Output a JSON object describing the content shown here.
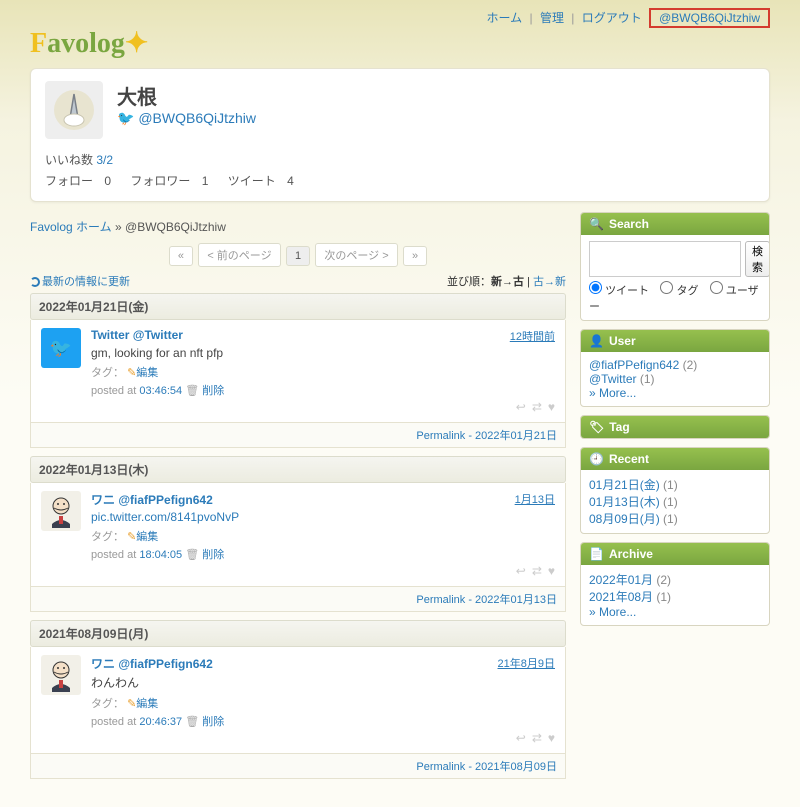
{
  "topbar": {
    "home": "ホーム",
    "admin": "管理",
    "logout": "ログアウト",
    "user": "@BWQB6QiJtzhiw"
  },
  "profile": {
    "display_name": "大根",
    "handle": "@BWQB6QiJtzhiw",
    "likes_label": "いいね数",
    "likes_ratio": "3/2",
    "follow_label": "フォロー",
    "follow_count": "0",
    "follower_label": "フォロワー",
    "follower_count": "1",
    "tweet_label": "ツイート",
    "tweet_count": "4"
  },
  "breadcrumb": {
    "home": "Favolog ホーム",
    "sep": " » ",
    "current": "@BWQB6QiJtzhiw"
  },
  "pager": {
    "first": "«",
    "prev": "< 前のページ",
    "page": "1",
    "next": "次のページ >",
    "last": "»"
  },
  "toolbar": {
    "refresh": "最新の情報に更新",
    "sort_label": "並び順：",
    "sort_new": "新→古",
    "sort_sep": " | ",
    "sort_old": "古→新"
  },
  "dates": [
    {
      "header": "2022年01月21日(金)",
      "permalink": "Permalink - 2022年01月21日",
      "tweet": {
        "name": "Twitter",
        "handle": "@Twitter",
        "ts": "12時間前",
        "text": "gm, looking for an nft pfp",
        "tag_label": "タグ：",
        "edit": "編集",
        "posted_label": "posted at ",
        "posted_time": "03:46:54",
        "delete": "削除"
      }
    },
    {
      "header": "2022年01月13日(木)",
      "permalink": "Permalink - 2022年01月13日",
      "tweet": {
        "name": "ワニ",
        "handle": "@fiafPPefign642",
        "ts": "1月13日",
        "text": "pic.twitter.com/8141pvoNvP",
        "tag_label": "タグ：",
        "edit": "編集",
        "posted_label": "posted at ",
        "posted_time": "18:04:05",
        "delete": "削除"
      }
    },
    {
      "header": "2021年08月09日(月)",
      "permalink": "Permalink - 2021年08月09日",
      "tweet": {
        "name": "ワニ",
        "handle": "@fiafPPefign642",
        "ts": "21年8月9日",
        "text": "わんわん",
        "tag_label": "タグ：",
        "edit": "編集",
        "posted_label": "posted at ",
        "posted_time": "20:46:37",
        "delete": "削除"
      }
    }
  ],
  "side": {
    "search": {
      "title": "Search",
      "button": "検索",
      "r1": "ツイート",
      "r2": "タグ",
      "r3": "ユーザー"
    },
    "user": {
      "title": "User",
      "items": [
        {
          "label": "@fiafPPefign642",
          "count": "(2)"
        },
        {
          "label": "@Twitter",
          "count": "(1)"
        }
      ],
      "more": "» More..."
    },
    "tag": {
      "title": "Tag"
    },
    "recent": {
      "title": "Recent",
      "items": [
        {
          "label": "01月21日(金)",
          "count": "(1)"
        },
        {
          "label": "01月13日(木)",
          "count": "(1)"
        },
        {
          "label": "08月09日(月)",
          "count": "(1)"
        }
      ]
    },
    "archive": {
      "title": "Archive",
      "items": [
        {
          "label": "2022年01月",
          "count": "(2)"
        },
        {
          "label": "2021年08月",
          "count": "(1)"
        }
      ],
      "more": "» More..."
    }
  }
}
